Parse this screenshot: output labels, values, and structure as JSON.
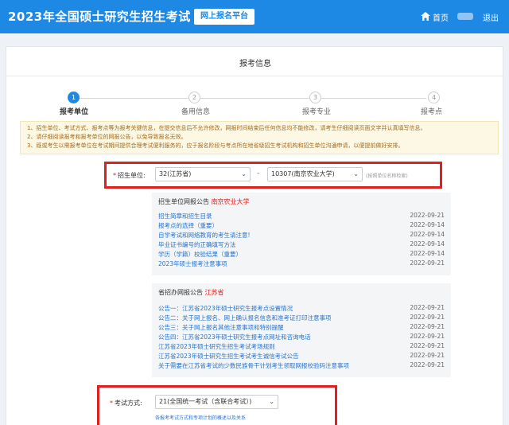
{
  "header": {
    "title": "2023年全国硕士研究生招生考试",
    "platform": "网上报名平台",
    "home": "首页",
    "logout": "退出"
  },
  "card": {
    "title": "报考信息"
  },
  "steps": [
    {
      "num": "1",
      "label": "报考单位",
      "active": true
    },
    {
      "num": "2",
      "label": "备用信息",
      "active": false
    },
    {
      "num": "3",
      "label": "报考专业",
      "active": false
    },
    {
      "num": "4",
      "label": "报考点",
      "active": false
    }
  ],
  "notice": [
    "1、招生单位、考试方式、报考点等为报考关键信息，在提交信息后不允许修改，网报时间结束后任何信息均不能修改，请考生仔细阅读页面文字并认真填写信息。",
    "2、请仔细阅读报考和报考单位的网报公告，以免导致报名无效。",
    "3、既或考生以需报考单位在考试期间提供合理考试便利服务的，应于报名阶段与考点所在地省级招生考试机构和招生单位沟通申请，以便提前做好安排。"
  ],
  "unit_form": {
    "label": "招生单位:",
    "province": "32(江苏省)",
    "school": "10307(南京农业大学)",
    "hint": "(按照单位名称检索)"
  },
  "school_announcements": {
    "heading": "招生单位网报公告",
    "org": "南京农业大学",
    "items": [
      {
        "title": "招生简章和招生目录",
        "date": "2022-09-21"
      },
      {
        "title": "报考点的选择（重要）",
        "date": "2022-09-14"
      },
      {
        "title": "自学考试和网络教育的考生请注意!",
        "date": "2022-09-14"
      },
      {
        "title": "毕业证书编号的正确填写方法",
        "date": "2022-09-14"
      },
      {
        "title": "学历（学籍）校验结果（重要）",
        "date": "2022-09-14"
      },
      {
        "title": "2023年硕士报考注意事项",
        "date": "2022-09-21"
      }
    ]
  },
  "province_announcements": {
    "heading": "省招办网报公告",
    "org": "江苏省",
    "items": [
      {
        "title": "公告一：江苏省2023年硕士研究生报考点设置情况",
        "date": "2022-09-21"
      },
      {
        "title": "公告二：关于网上报名、网上确认报名信息和准考证打印注意事项",
        "date": "2022-09-21"
      },
      {
        "title": "公告三：关于网上报名其他注意事项和特别提醒",
        "date": "2022-09-21"
      },
      {
        "title": "公告四：江苏省2023年硕士研究生报考点网址和咨询电话",
        "date": "2022-09-21"
      },
      {
        "title": "江苏省2023年硕士研究生招生考试考场规则",
        "date": "2022-09-21"
      },
      {
        "title": "江苏省2023年硕士研究生招生考试考生诚信考试公告",
        "date": "2022-09-21"
      },
      {
        "title": "关于需要在江苏省考试的少数民族骨干计划考生领取网报校验码注意事项",
        "date": "2022-09-21"
      }
    ]
  },
  "exam_form": {
    "label": "考试方式:",
    "value": "21(全国统一考试（含联合考试）)",
    "note": "各报考考试方式和专项计划的概述以及关系"
  },
  "colors": {
    "primary": "#1e88e5",
    "highlight_border": "#e02020",
    "link": "#2a73c9",
    "notice_bg": "#fdf8e4"
  }
}
